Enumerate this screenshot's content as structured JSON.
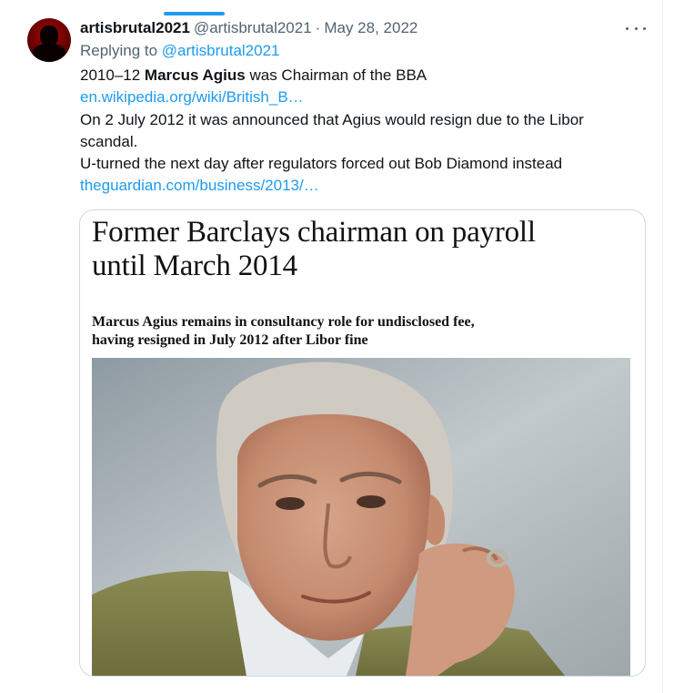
{
  "tweet": {
    "display_name": "artisbrutal2021",
    "handle": "@artisbrutal2021",
    "separator": "·",
    "date": "May 28, 2022",
    "replying_prefix": "Replying to ",
    "replying_handle": "@artisbrutal2021",
    "body": {
      "line1_prefix": "2010–12 ",
      "line1_bold": "Marcus Agius",
      "line1_suffix": " was Chairman of the BBA",
      "link1": "en.wikipedia.org/wiki/British_B…",
      "line3": "On 2 July 2012 it was announced that Agius would resign due to the Libor",
      "line4": "scandal.",
      "line5": "U-turned the next day  after regulators forced out Bob Diamond instead",
      "link2": "theguardian.com/business/2013/…"
    }
  },
  "card": {
    "headline_line1": "Former Barclays chairman on payroll",
    "headline_line2": "until March 2014",
    "standfirst_line1": "Marcus Agius remains in consultancy role for undisclosed fee,",
    "standfirst_line2": "having resigned in July 2012 after Libor fine"
  },
  "icons": {
    "more": "more-options-icon",
    "avatar": "avatar-icon"
  },
  "colors": {
    "link": "#1d9bf0",
    "secondary_text": "#536471",
    "primary_text": "#0f1419",
    "card_border": "#cfd9de"
  }
}
